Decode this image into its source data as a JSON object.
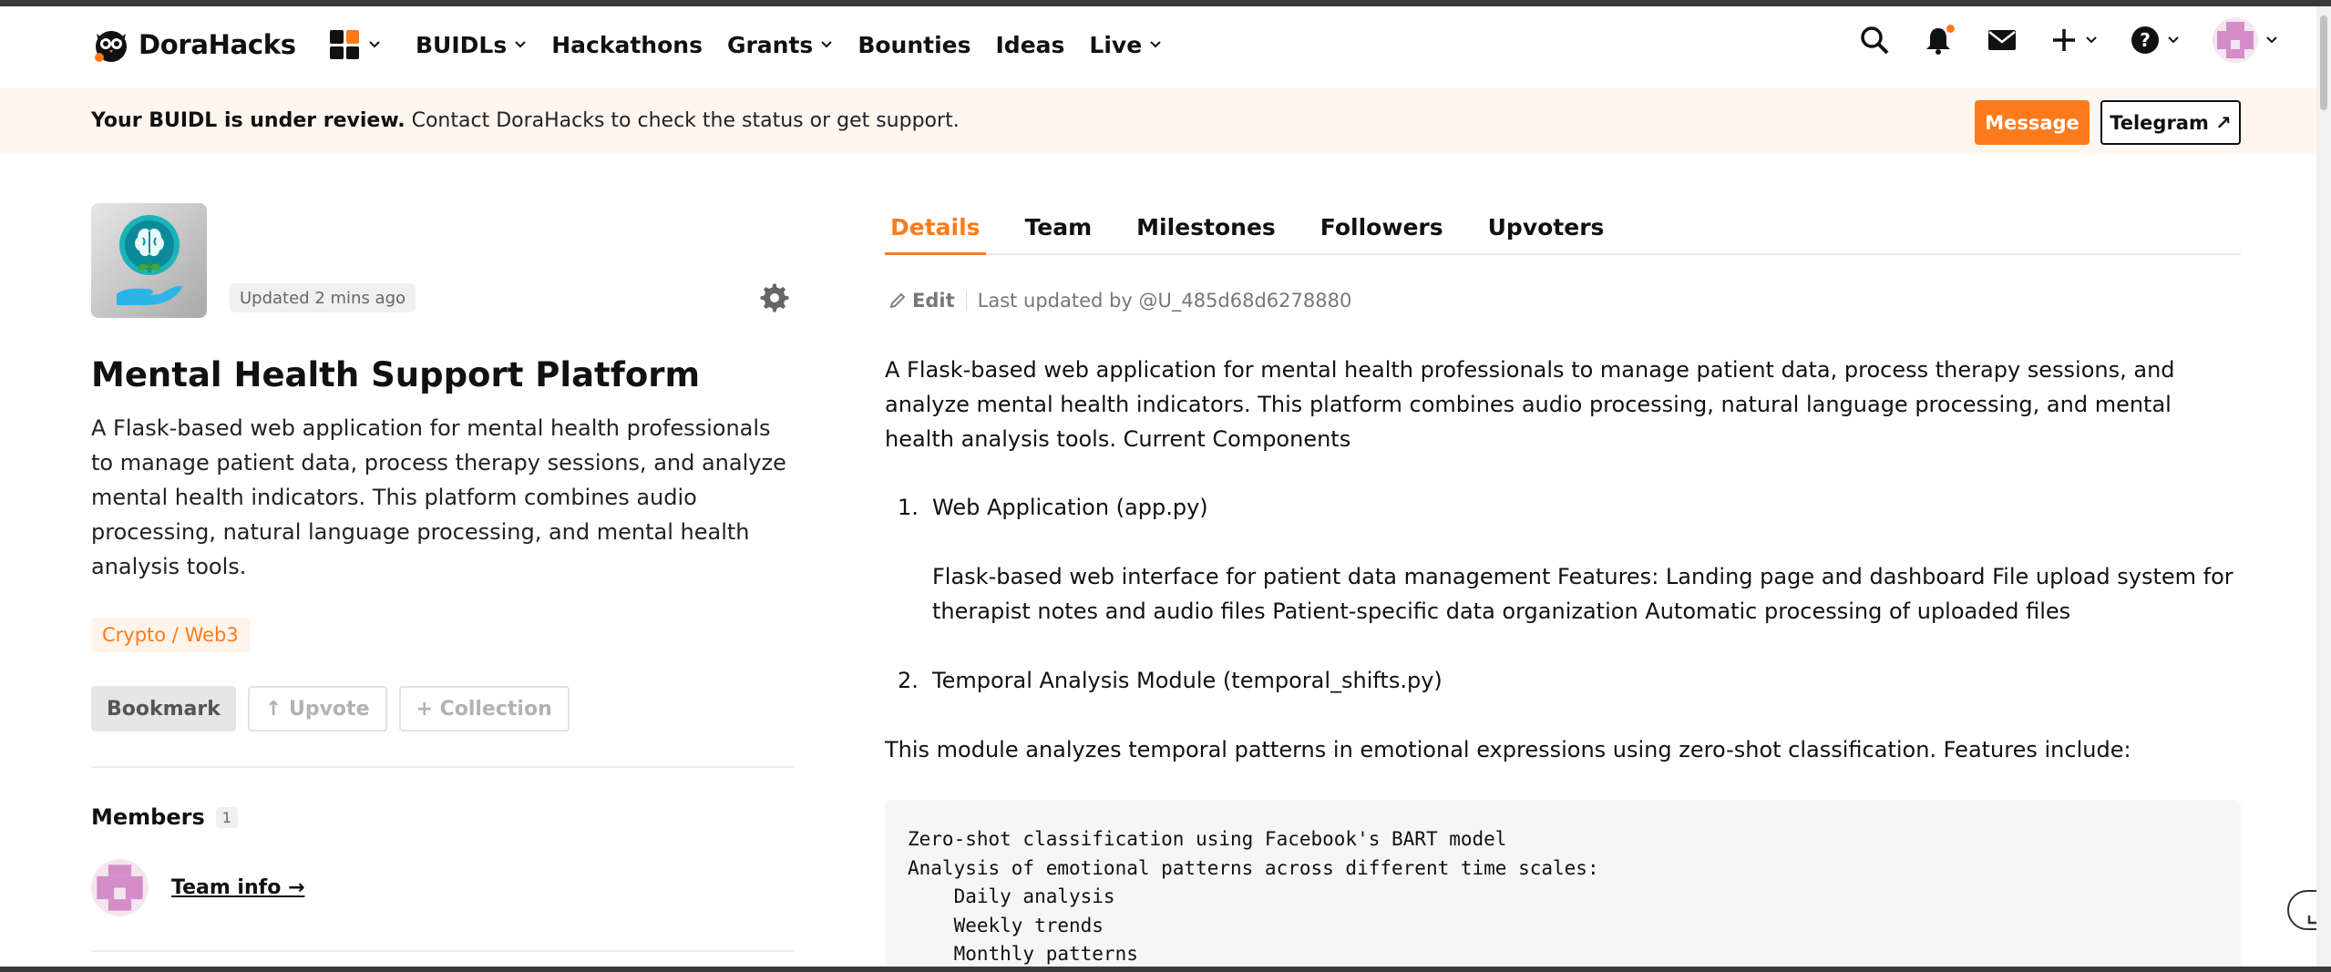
{
  "header": {
    "brand": "DoraHacks",
    "nav": [
      {
        "label": "BUIDLs",
        "dropdown": true
      },
      {
        "label": "Hackathons",
        "dropdown": false
      },
      {
        "label": "Grants",
        "dropdown": true
      },
      {
        "label": "Bounties",
        "dropdown": false
      },
      {
        "label": "Ideas",
        "dropdown": false
      },
      {
        "label": "Live",
        "dropdown": true
      }
    ],
    "icons": [
      "search-icon",
      "bell-icon",
      "mail-icon",
      "plus-icon",
      "help-icon",
      "avatar"
    ]
  },
  "banner": {
    "bold": "Your BUIDL is under review.",
    "text": " Contact DoraHacks to check the status or get support.",
    "message_button": "Message",
    "telegram_button": "Telegram ↗"
  },
  "project": {
    "updated": "Updated 2 mins ago",
    "title": "Mental Health Support Platform",
    "description": "A Flask-based web application for mental health professionals to manage patient data, process therapy sessions, and analyze mental health indicators. This platform combines audio processing, natural language processing, and mental health analysis tools.",
    "tag": "Crypto / Web3",
    "actions": {
      "bookmark": "Bookmark",
      "upvote": "↑ Upvote",
      "collection": "+ Collection"
    },
    "members_label": "Members",
    "members_count": "1",
    "team_info": "Team info →"
  },
  "tabs": [
    {
      "label": "Details",
      "active": true
    },
    {
      "label": "Team",
      "active": false
    },
    {
      "label": "Milestones",
      "active": false
    },
    {
      "label": "Followers",
      "active": false
    },
    {
      "label": "Upvoters",
      "active": false
    }
  ],
  "details": {
    "edit": "Edit",
    "last_updated": "Last updated by @U_485d68d6278880",
    "intro": "A Flask-based web application for mental health professionals to manage patient data, process therapy sessions, and analyze mental health indicators. This platform combines audio processing, natural language processing, and mental health analysis tools. Current Components",
    "item1_num": "1.",
    "item1_title": "Web Application (app.py)",
    "item1_body": "Flask-based web interface for patient data management Features: Landing page and dashboard File upload system for therapist notes and audio files Patient-specific data organization Automatic processing of uploaded files",
    "item2_num": "2.",
    "item2_title": "Temporal Analysis Module (temporal_shifts.py)",
    "module_text": "This module analyzes temporal patterns in emotional expressions using zero-shot classification. Features include:",
    "code_lines": [
      "Zero-shot classification using Facebook's BART model",
      "Analysis of emotional patterns across different time scales:",
      "    Daily analysis",
      "    Weekly trends",
      "    Monthly patterns"
    ]
  },
  "colors": {
    "accent": "#ff7a1a",
    "banner_bg": "#fff6f0"
  }
}
